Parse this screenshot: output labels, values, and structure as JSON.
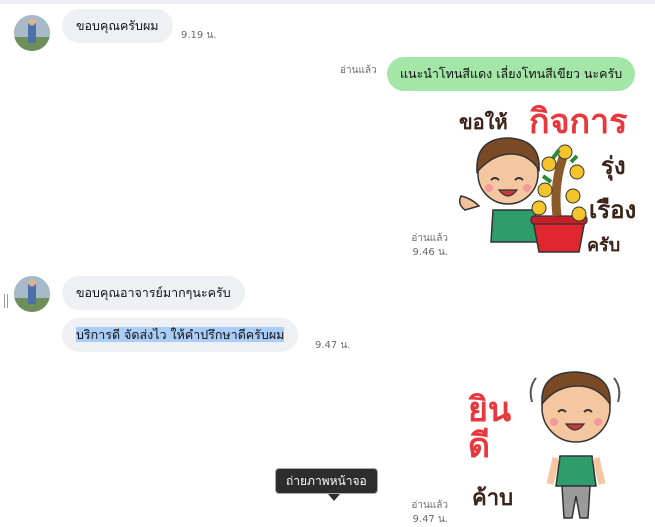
{
  "messages": [
    {
      "text": "ขอบคุณครับผม",
      "time": "9.19 น."
    },
    {
      "text": "แนะนำโทนสีแดง เลี่ยงโทนสีเขียว นะครับ",
      "read": "อ่านแล้ว"
    },
    {
      "sticker_words": [
        "ขอให้",
        "กิจการ",
        "รุ่ง",
        "เรือง",
        "ครับ"
      ],
      "read": "อ่านแล้ว",
      "time": "9.46 น."
    },
    {
      "text": "ขอบคุณอาจารย์มากๆนะครับ"
    },
    {
      "text": "บริการดี จัดส่งไว ให้คำปรึกษาดีครับผม",
      "time": "9.47 น."
    },
    {
      "sticker_words": [
        "ยินดี",
        "ค้าบ"
      ],
      "read": "อ่านแล้ว",
      "time": "9.47 น."
    }
  ],
  "tooltip": {
    "label": "ถ่ายภาพหน้าจอ"
  },
  "colors": {
    "incoming_bubble": "#eef0f3",
    "outgoing_bubble": "#a3e6a8",
    "selection": "#a9cdf7",
    "sticker_red": "#e8383d"
  }
}
